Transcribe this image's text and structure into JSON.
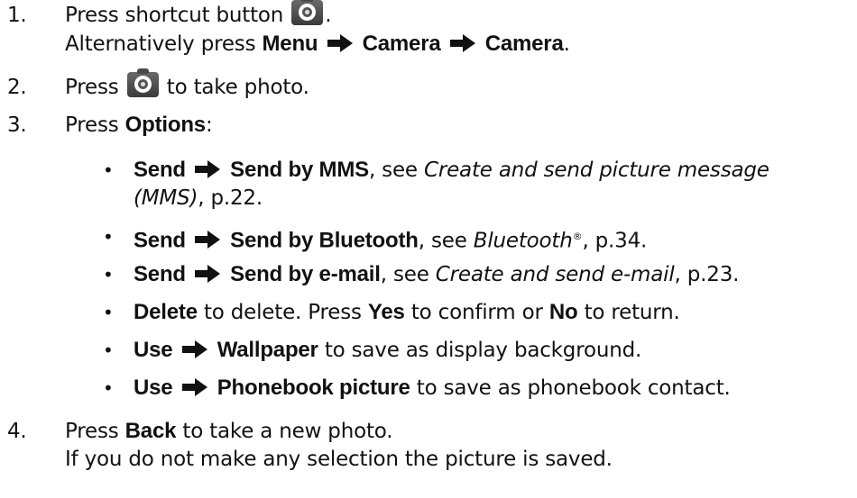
{
  "steps": [
    {
      "num": "1.",
      "press": "Press shortcut button",
      "end": ".",
      "alt_prefix": "Alternatively press",
      "alt_menu": "Menu",
      "alt_camera1": "Camera",
      "alt_camera2": "Camera",
      "alt_end": "."
    },
    {
      "num": "2.",
      "press": "Press",
      "after": "to take photo."
    },
    {
      "num": "3.",
      "press": "Press",
      "options": "Options",
      "colon": ":"
    },
    {
      "num": "4.",
      "press": "Press",
      "back": "Back",
      "after": "to take a new photo.",
      "note": "If you do not make any selection the picture is saved."
    }
  ],
  "bullets": [
    {
      "a": "Send",
      "b": "Send by MMS",
      "see": ", see",
      "ref": "Create and send picture message",
      "ref2": "(MMS)",
      "page": ", p.22."
    },
    {
      "a": "Send",
      "b": "Send by Bluetooth",
      "see": ", see",
      "ref": "Bluetooth",
      "reg": "®",
      "page": ", p.34."
    },
    {
      "a": "Send",
      "b": "Send by e-mail",
      "see": ", see",
      "ref": "Create and send e-mail",
      "page": ", p.23."
    },
    {
      "a": "Delete",
      "t1": "to delete. Press",
      "yes": "Yes",
      "t2": "to confirm or",
      "no": "No",
      "t3": "to return."
    },
    {
      "a": "Use",
      "b": "Wallpaper",
      "after": "to save as display background."
    },
    {
      "a": "Use",
      "b": "Phonebook picture",
      "after": "to save as phonebook contact."
    }
  ],
  "bullet_glyph": "•",
  "icons": {
    "camera": "camera-button-icon",
    "arrow": "right-arrow-icon"
  }
}
